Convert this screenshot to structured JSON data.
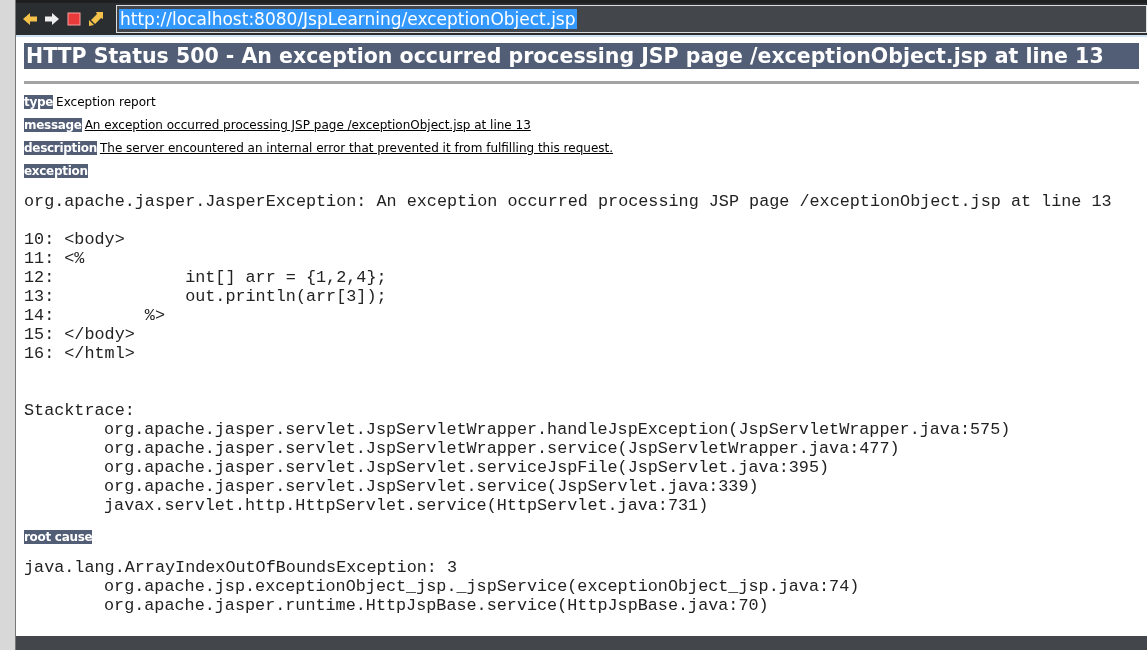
{
  "toolbar": {
    "url": "http://localhost:8080/JspLearning/exceptionObject.jsp"
  },
  "heading": "HTTP Status 500 - An exception occurred processing JSP page /exceptionObject.jsp at line 13",
  "fields": [
    {
      "label": "type",
      "value": "Exception report",
      "underlined": false
    },
    {
      "label": "message",
      "value": "An exception occurred processing JSP page /exceptionObject.jsp at line 13",
      "underlined": true
    },
    {
      "label": "description",
      "value": "The server encountered an internal error that prevented it from fulfilling this request.",
      "underlined": true
    }
  ],
  "exception_label": "exception",
  "exception_lines": [
    {
      "kind": "head",
      "text": "org.apache.jasper.JasperException: An exception occurred processing JSP page /exceptionObject.jsp at line 13"
    },
    {
      "kind": "blank"
    },
    {
      "kind": "code",
      "text": "10: <body>"
    },
    {
      "kind": "code",
      "text": "11: <%"
    },
    {
      "kind": "code",
      "text": "12:             int[] arr = {1,2,4};"
    },
    {
      "kind": "code",
      "text": "13:             out.println(arr[3]);"
    },
    {
      "kind": "code",
      "text": "14:         %>"
    },
    {
      "kind": "code",
      "text": "15: </body>"
    },
    {
      "kind": "code",
      "text": "16: </html>"
    },
    {
      "kind": "blank"
    },
    {
      "kind": "blank"
    },
    {
      "kind": "head",
      "text": "Stacktrace:"
    },
    {
      "kind": "frame",
      "text": "org.apache.jasper.servlet.JspServletWrapper.handleJspException(JspServletWrapper.java:575)"
    },
    {
      "kind": "frame",
      "text": "org.apache.jasper.servlet.JspServletWrapper.service(JspServletWrapper.java:477)"
    },
    {
      "kind": "frame",
      "text": "org.apache.jasper.servlet.JspServlet.serviceJspFile(JspServlet.java:395)"
    },
    {
      "kind": "frame",
      "text": "org.apache.jasper.servlet.JspServlet.service(JspServlet.java:339)"
    },
    {
      "kind": "frame",
      "text": "javax.servlet.http.HttpServlet.service(HttpServlet.java:731)"
    }
  ],
  "root_cause_label": "root cause",
  "root_cause_lines": [
    {
      "kind": "head",
      "text": "java.lang.ArrayIndexOutOfBoundsException: 3"
    },
    {
      "kind": "frame",
      "text": "org.apache.jsp.exceptionObject_jsp._jspService(exceptionObject_jsp.java:74)"
    },
    {
      "kind": "frame",
      "text": "org.apache.jasper.runtime.HttpJspBase.service(HttpJspBase.java:70)"
    }
  ]
}
